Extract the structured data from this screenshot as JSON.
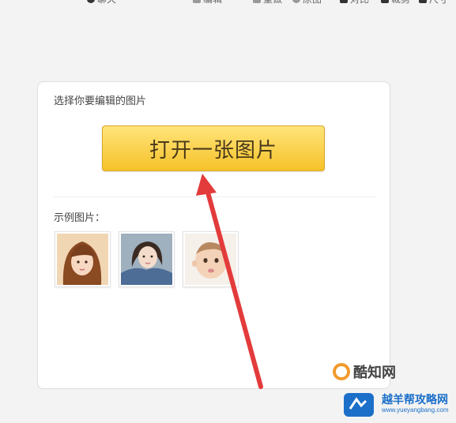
{
  "toolbar": {
    "items": [
      {
        "label": "聊天",
        "icon": "search-icon"
      },
      {
        "label": "编辑",
        "icon": "diamond-icon"
      },
      {
        "label": "重做",
        "icon": "diamond-icon"
      },
      {
        "label": "原图",
        "icon": "circle-icon"
      },
      {
        "label": "对比",
        "icon": "compare-icon"
      },
      {
        "label": "裁剪",
        "icon": "crop-icon"
      },
      {
        "label": "尺寸",
        "icon": "resize-icon"
      }
    ]
  },
  "panel": {
    "title": "选择你要编辑的图片",
    "open_button": "打开一张图片",
    "examples_label": "示例图片："
  },
  "examples": [
    {
      "name": "example-photo-1",
      "subject": "woman-with-bangs"
    },
    {
      "name": "example-photo-2",
      "subject": "woman-denim-jacket"
    },
    {
      "name": "example-photo-3",
      "subject": "baby"
    }
  ],
  "annotation": {
    "type": "arrow",
    "color": "#e33b3b"
  },
  "watermarks": {
    "brand1": "酷知网",
    "brand2_name": "越羊帮攻略网",
    "brand2_url": "www.yueyangbang.com"
  },
  "colors": {
    "button_top": "#ffe47a",
    "button_bottom": "#f6c229",
    "arrow": "#e33b3b"
  }
}
